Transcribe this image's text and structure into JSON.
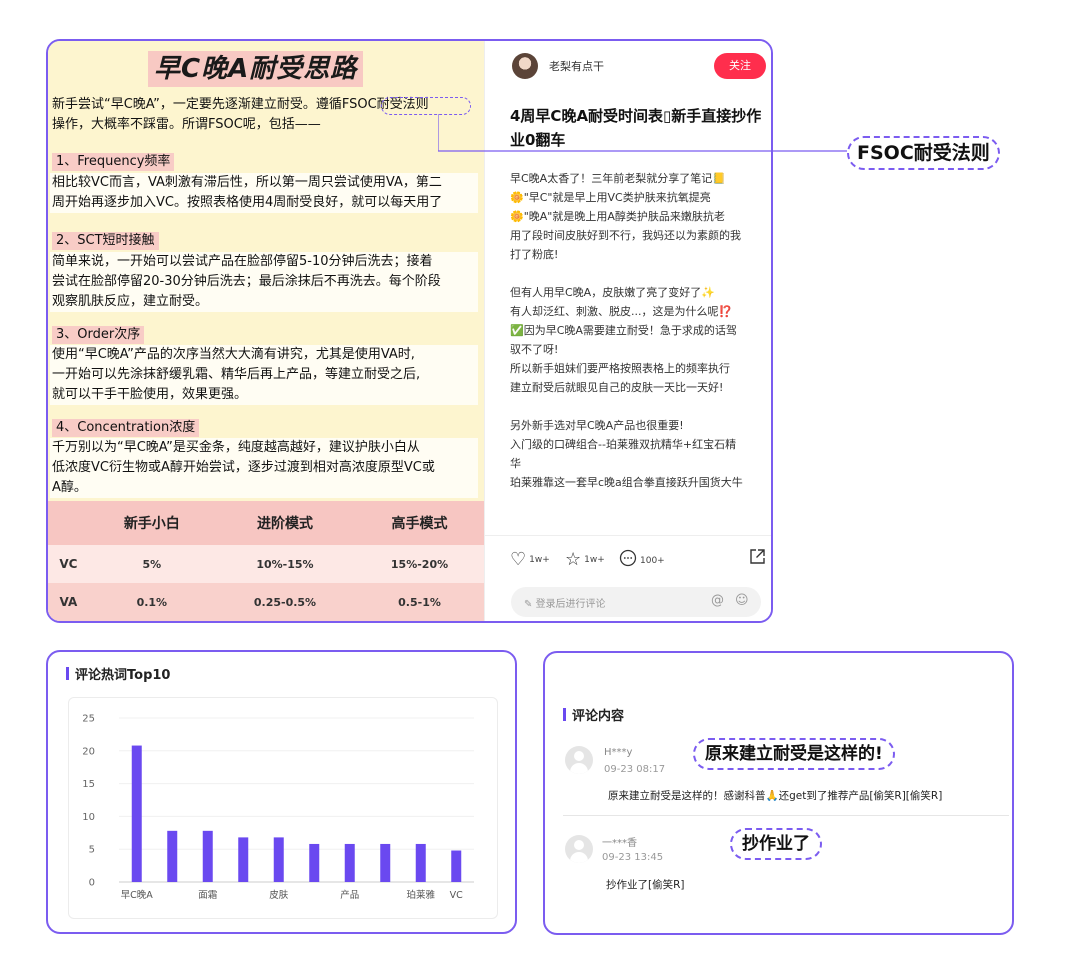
{
  "note": {
    "title": "早C晚A耐受思路",
    "intro_1": "新手尝试“早C晚A”，一定要先逐渐建立耐受。遵循FSOC耐受法则",
    "intro_2": "操作，大概率不踩雷。所谓FSOC呢，包括——",
    "sections": [
      {
        "head": "1、Frequency频率",
        "lines": [
          "相比较VC而言，VA刺激有滞后性，所以第一周只尝试使用VA，第二",
          "周开始再逐步加入VC。按照表格使用4周耐受良好，就可以每天用了"
        ]
      },
      {
        "head": "2、SCT短时接触",
        "lines": [
          "简单来说，一开始可以尝试产品在脸部停留5-10分钟后洗去；接着",
          "尝试在脸部停留20-30分钟后洗去；最后涂抹后不再洗去。每个阶段",
          "观察肌肤反应，建立耐受。"
        ]
      },
      {
        "head": "3、Order次序",
        "lines": [
          "使用“早C晚A”产品的次序当然大大滴有讲究，尤其是使用VA时,",
          "一开始可以先涂抹舒缓乳霜、精华后再上产品，等建立耐受之后,",
          "就可以干手干脸使用，效果更强。"
        ]
      },
      {
        "head": "4、Concentration浓度",
        "lines": [
          "千万别以为“早C晚A”是买金条，纯度越高越好，建议护肤小白从",
          "低浓度VC衍生物或A醇开始尝试，逐步过渡到相对高浓度原型VC或",
          "A醇。"
        ]
      }
    ],
    "table": {
      "headers": [
        "",
        "新手小白",
        "进阶模式",
        "高手模式"
      ],
      "rows": [
        [
          "VC",
          "5%",
          "10%-15%",
          "15%-20%"
        ],
        [
          "VA",
          "0.1%",
          "0.25-0.5%",
          "0.5-1%"
        ]
      ]
    }
  },
  "post": {
    "author": "老梨有点干",
    "follow_label": "关注",
    "title_line1": "4周早C晚A耐受时间表▯新手直接抄作",
    "title_line2": "业0翻车",
    "body_lines": [
      "早C晚A太香了！三年前老梨就分享了笔记📒",
      "🌼\"早C\"就是早上用VC类护肤来抗氧提亮",
      "🌼\"晚A\"就是晚上用A醇类护肤品来嫩肤抗老",
      "用了段时间皮肤好到不行，我妈还以为素颜的我",
      "打了粉底!",
      "",
      "但有人用早C晚A，皮肤嫩了亮了变好了✨",
      "有人却泛红、刺激、脱皮...，这是为什么呢⁉️",
      "✅因为早C晚A需要建立耐受！急于求成的话驾",
      "驭不了呀!",
      "所以新手姐妹们要严格按照表格上的频率执行",
      "建立耐受后就眼见自己的皮肤一天比一天好!",
      "",
      "另外新手选对早C晚A产品也很重要!",
      "入门级的口碑组合--珀莱雅双抗精华+红宝石精",
      "华",
      "珀莱雅靠这一套早c晚a组合拳直接跃升国货大牛"
    ],
    "likes": "1w+",
    "collects": "1w+",
    "comments": "100+",
    "comment_placeholder": "登录后进行评论",
    "icons": {
      "like": "heart-icon",
      "collect": "star-icon",
      "comment": "comment-bubble-icon",
      "share": "share-icon",
      "at": "at-icon",
      "emoji": "emoji-icon"
    }
  },
  "callout": {
    "label": "FSOC耐受法则"
  },
  "chart_section": {
    "title": "评论热词Top10"
  },
  "chart_data": {
    "type": "bar",
    "title": "评论热词Top10",
    "categories": [
      "早C晚A",
      "",
      "面霜",
      "",
      "皮肤",
      "",
      "产品",
      "",
      "珀莱雅",
      "VC"
    ],
    "tick_labels": [
      "早C晚A",
      "面霜",
      "皮肤",
      "产品",
      "珀莱雅",
      "VC"
    ],
    "values": [
      20.8,
      7.8,
      7.8,
      6.8,
      6.8,
      5.8,
      5.8,
      5.8,
      5.8,
      4.8
    ],
    "ylim": [
      0,
      25
    ],
    "yticks": [
      0,
      5,
      10,
      15,
      20,
      25
    ],
    "grid": true,
    "color": "#6a49f0"
  },
  "comments_section": {
    "title": "评论内容",
    "items": [
      {
        "user": "H***y",
        "date": "09-23 08:17",
        "text": "原来建立耐受是这样的！感谢科普🙏还get到了推荐产品[偷笑R][偷笑R]",
        "bubble": "原来建立耐受是这样的!"
      },
      {
        "user": "一***香",
        "date": "09-23 13:45",
        "text": "抄作业了[偷笑R]",
        "bubble": "抄作业了"
      }
    ]
  },
  "colors": {
    "accent": "#7b5cf0",
    "bar": "#6a49f0",
    "follow": "#ff2e4d",
    "note_bg": "#fdf5cf",
    "highlight": "#f8ccc6"
  }
}
